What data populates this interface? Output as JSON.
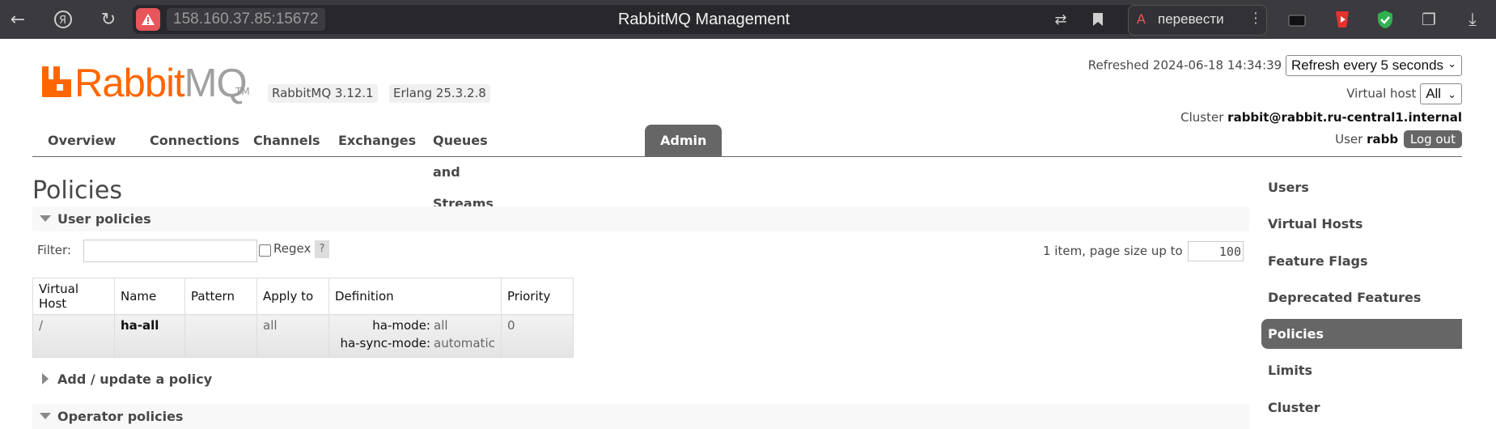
{
  "browser": {
    "address": "158.160.37.85:15672",
    "tab_title": "RabbitMQ Management",
    "translate_label": "перевести"
  },
  "header": {
    "logo_rabbit": "Rabbit",
    "logo_mq": "MQ",
    "logo_tm": "TM",
    "rabbitmq_version": "RabbitMQ 3.12.1",
    "erlang_version": "Erlang 25.3.2.8",
    "refreshed_prefix": "Refreshed",
    "refreshed_time": "2024-06-18 14:34:39",
    "refresh_select": "Refresh every 5 seconds",
    "vhost_label": "Virtual host",
    "vhost_select": "All",
    "cluster_label": "Cluster",
    "cluster_name": "rabbit@rabbit.ru-central1.internal",
    "user_label": "User",
    "user_name": "rabb",
    "logout_label": "Log out"
  },
  "tabs": [
    {
      "label": "Overview"
    },
    {
      "label": "Connections"
    },
    {
      "label": "Channels"
    },
    {
      "label": "Exchanges"
    },
    {
      "label": "Queues and Streams"
    },
    {
      "label": "Admin",
      "active": true
    }
  ],
  "main": {
    "title": "Policies",
    "user_policies_label": "User policies",
    "filter_label": "Filter:",
    "filter_value": "",
    "regex_label": "Regex",
    "help_label": "?",
    "pager_text": "1 item, page size up to",
    "page_size": "100",
    "table": {
      "headers": [
        "Virtual Host",
        "Name",
        "Pattern",
        "Apply to",
        "Definition",
        "Priority"
      ],
      "rows": [
        {
          "vhost": "/",
          "name": "ha-all",
          "pattern": "",
          "apply_to": "all",
          "definition": [
            {
              "key": "ha-mode:",
              "value": "all"
            },
            {
              "key": "ha-sync-mode:",
              "value": "automatic"
            }
          ],
          "priority": "0"
        }
      ]
    },
    "add_policy_label": "Add / update a policy",
    "operator_policies_label": "Operator policies"
  },
  "sidebar": {
    "items": [
      {
        "label": "Users"
      },
      {
        "label": "Virtual Hosts"
      },
      {
        "label": "Feature Flags"
      },
      {
        "label": "Deprecated Features"
      },
      {
        "label": "Policies",
        "active": true
      },
      {
        "label": "Limits"
      },
      {
        "label": "Cluster"
      }
    ]
  },
  "colors": {
    "brand_orange": "#ff6600",
    "active_tab": "#666666",
    "browser_chrome": "#3a3a3f"
  }
}
